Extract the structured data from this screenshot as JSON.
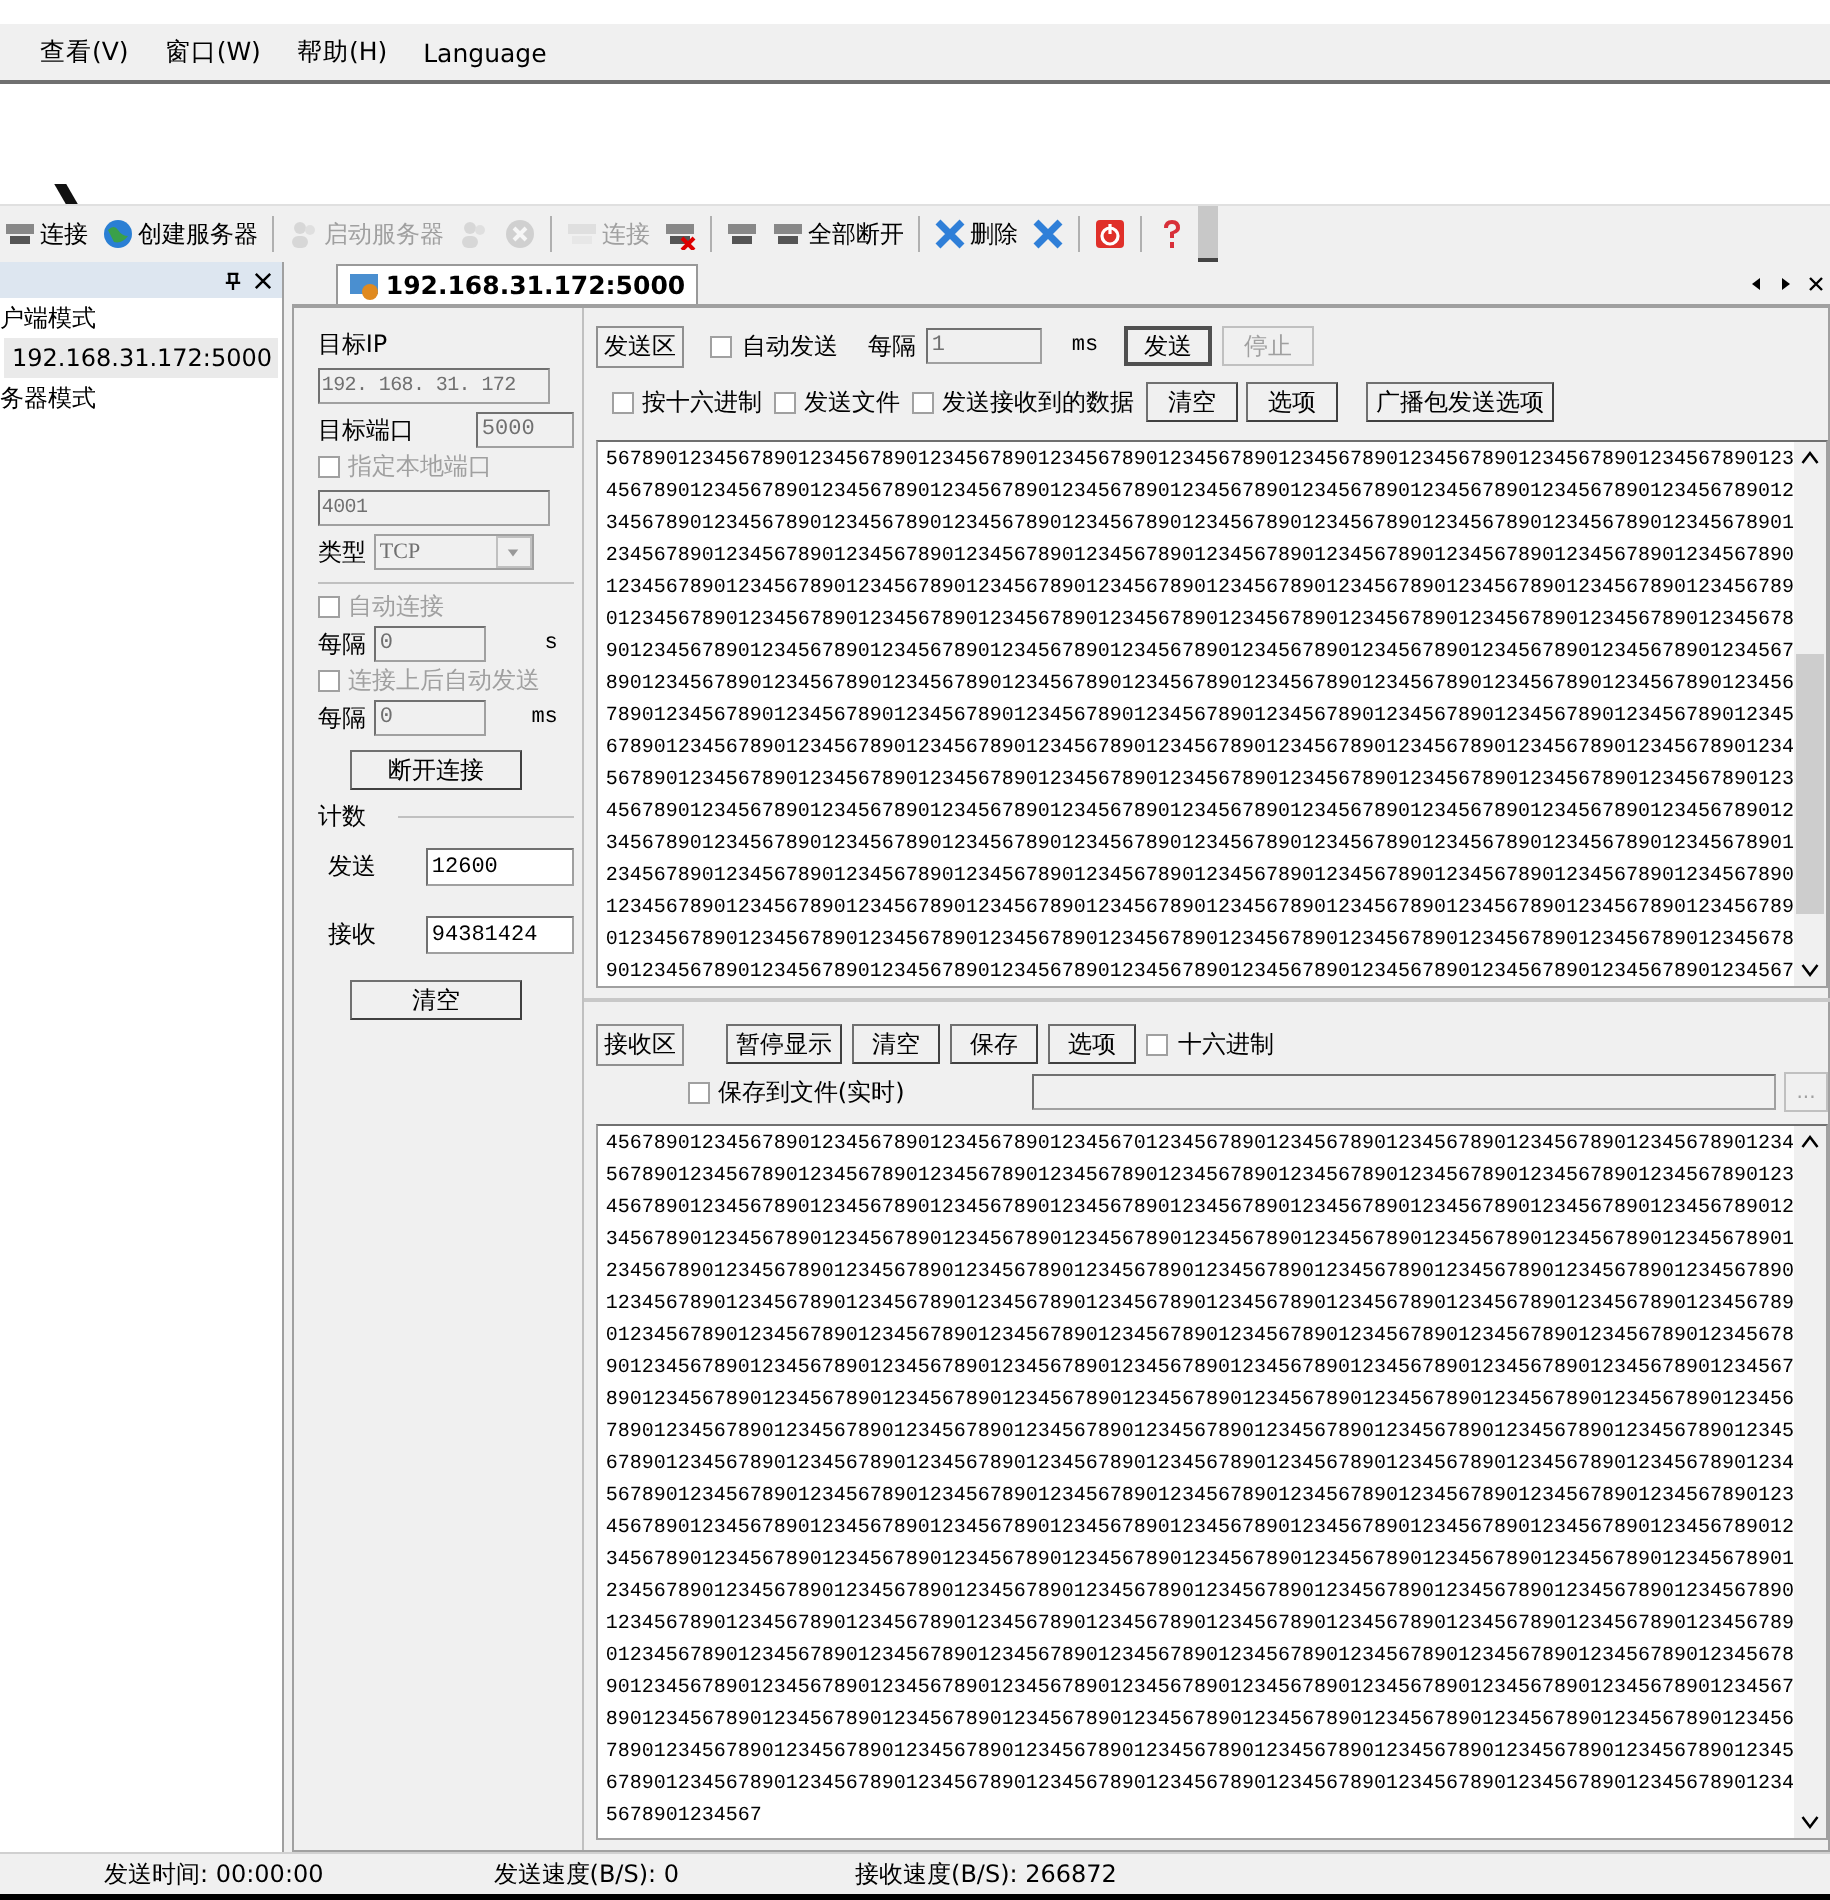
{
  "menu": [
    {
      "label": "查看(V)"
    },
    {
      "label": "窗口(W)"
    },
    {
      "label": "帮助(H)"
    },
    {
      "label": "Language"
    }
  ],
  "toolbar": [
    {
      "kind": "button",
      "label": "连接",
      "disabled": false
    },
    {
      "kind": "button",
      "label": "创建服务器",
      "disabled": false
    },
    {
      "kind": "separator"
    },
    {
      "kind": "button",
      "label": "启动服务器",
      "disabled": true
    },
    {
      "kind": "button",
      "disabled": true
    },
    {
      "kind": "button",
      "disabled": true
    },
    {
      "kind": "separator"
    },
    {
      "kind": "button",
      "label": "连接",
      "disabled": true
    },
    {
      "kind": "button",
      "disabled": false
    },
    {
      "kind": "separator"
    },
    {
      "kind": "button",
      "disabled": false
    },
    {
      "kind": "button",
      "label": "全部断开",
      "disabled": false
    },
    {
      "kind": "separator"
    },
    {
      "kind": "button",
      "label": "删除",
      "disabled": false
    },
    {
      "kind": "button",
      "disabled": false
    },
    {
      "kind": "separator"
    },
    {
      "kind": "button",
      "disabled": false
    },
    {
      "kind": "separator"
    },
    {
      "kind": "button",
      "disabled": false
    }
  ],
  "tree": [
    {
      "label": "户端模式",
      "selected": false,
      "children": [
        {
          "label": "192.168.31.172:5000",
          "selected": true
        }
      ]
    },
    {
      "label": "务器模式",
      "selected": false
    }
  ],
  "tabs": [
    {
      "label": "192.168.31.172:5000",
      "selected": true
    }
  ],
  "connection": {
    "target_ip_label": "目标IP",
    "target_ip": "192. 168. 31. 172",
    "target_port_label": "目标端口",
    "target_port": "5000",
    "local_port_check": {
      "label": "指定本地端口",
      "checked": false
    },
    "local_port": "4001",
    "type_label": "类型",
    "type": "TCP",
    "auto_connect": {
      "label": "自动连接",
      "checked": false
    },
    "interval_label": "每隔",
    "interval": "0",
    "interval_unit": "s",
    "auto_send": {
      "label": "连接上后自动发送",
      "checked": false
    },
    "auto_interval_label": "每隔",
    "auto_interval": "0",
    "auto_interval_unit": "ms",
    "disconnect_button": "断开连接",
    "disabled": true
  },
  "counter": {
    "title": "计数",
    "sent_label": "发送",
    "sent": "12600",
    "received_label": "接收",
    "received": "94381424",
    "clear_button": "清空"
  },
  "send": {
    "title": "发送区",
    "auto_send": {
      "label": "自动发送",
      "checked": false
    },
    "interval_label": "每隔",
    "interval": "1",
    "unit": "ms",
    "send_button": "发送",
    "stop_button": {
      "label": "停止",
      "disabled": true
    },
    "options": [
      {
        "label": "按十六进制",
        "checked": false
      },
      {
        "label": "发送文件",
        "checked": false
      },
      {
        "label": "发送接收到的数据",
        "checked": false
      }
    ],
    "buttons": [
      "清空",
      "选项",
      "广播包发送选项"
    ],
    "lines": [
      "567890123456789012345678901234567890123456789012345678901234567890123456789012345678901234567890123",
      "456789012345678901234567890123456789012345678901234567890123456789012345678901234567890123456789012",
      "345678901234567890123456789012345678901234567890123456789012345678901234567890123456789012345678901",
      "234567890123456789012345678901234567890123456789012345678901234567890123456789012345678901234567890",
      "123456789012345678901234567890123456789012345678901234567890123456789012345678901234567890123456789",
      "012345678901234567890123456789012345678901234567890123456789012345678901234567890123456789012345678",
      "901234567890123456789012345678901234567890123456789012345678901234567890123456789012345678901234567",
      "890123456789012345678901234567890123456789012345678901234567890123456789012345678901234567890123456",
      "789012345678901234567890123456789012345678901234567890123456789012345678901234567890123456789012345",
      "678901234567890123456789012345678901234567890123456789012345678901234567890123456789012345678901234",
      "567890123456789012345678901234567890123456789012345678901234567890123456789012345678901234567890123",
      "456789012345678901234567890123456789012345678901234567890123456789012345678901234567890123456789012",
      "345678901234567890123456789012345678901234567890123456789012345678901234567890123456789012345678901",
      "234567890123456789012345678901234567890123456789012345678901234567890123456789012345678901234567890",
      "123456789012345678901234567890123456789012345678901234567890123456789012345678901234567890123456789",
      "012345678901234567890123456789012345678901234567890123456789012345678901234567890123456789012345678",
      "901234567890123456789012345678901234567890123456789012345678901234567890123456789012345678901234567"
    ]
  },
  "receive": {
    "title": "接收区",
    "buttons": [
      "暂停显示",
      "清空",
      "保存",
      "选项"
    ],
    "hex": {
      "label": "十六进制",
      "checked": false
    },
    "save_to_file": {
      "label": "保存到文件(实时)",
      "checked": false
    },
    "browse_button": "...",
    "lines": [
      "456789012345678901234567890123456789012345670123456789012345678901234567890123456789012345678901234",
      "567890123456789012345678901234567890123456789012345678901234567890123456789012345678901234567890123",
      "456789012345678901234567890123456789012345678901234567890123456789012345678901234567890123456789012",
      "345678901234567890123456789012345678901234567890123456789012345678901234567890123456789012345678901",
      "234567890123456789012345678901234567890123456789012345678901234567890123456789012345678901234567890",
      "123456789012345678901234567890123456789012345678901234567890123456789012345678901234567890123456789",
      "012345678901234567890123456789012345678901234567890123456789012345678901234567890123456789012345678",
      "901234567890123456789012345678901234567890123456789012345678901234567890123456789012345678901234567",
      "890123456789012345678901234567890123456789012345678901234567890123456789012345678901234567890123456",
      "789012345678901234567890123456789012345678901234567890123456789012345678901234567890123456789012345",
      "678901234567890123456789012345678901234567890123456789012345678901234567890123456789012345678901234",
      "567890123456789012345678901234567890123456789012345678901234567890123456789012345678901234567890123",
      "456789012345678901234567890123456789012345678901234567890123456789012345678901234567890123456789012",
      "345678901234567890123456789012345678901234567890123456789012345678901234567890123456789012345678901",
      "234567890123456789012345678901234567890123456789012345678901234567890123456789012345678901234567890",
      "123456789012345678901234567890123456789012345678901234567890123456789012345678901234567890123456789",
      "012345678901234567890123456789012345678901234567890123456789012345678901234567890123456789012345678",
      "901234567890123456789012345678901234567890123456789012345678901234567890123456789012345678901234567",
      "890123456789012345678901234567890123456789012345678901234567890123456789012345678901234567890123456",
      "789012345678901234567890123456789012345678901234567890123456789012345678901234567890123456789012345",
      "678901234567890123456789012345678901234567890123456789012345678901234567890123456789012345678901234",
      "5678901234567"
    ]
  },
  "status_bar": {
    "send_time": "发送时间: 00:00:00",
    "send_speed": "发送速度(B/S): 0",
    "receive_speed": "接收速度(B/S): 266872"
  }
}
